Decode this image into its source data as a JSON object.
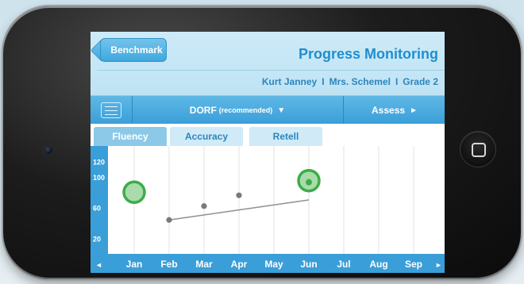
{
  "header": {
    "back_button": "Benchmark",
    "title": "Progress Monitoring",
    "student": "Kurt Janney",
    "teacher": "Mrs. Schemel",
    "grade": "Grade 2",
    "separator": "I"
  },
  "toolbar": {
    "list_icon": "list-icon",
    "measure": "DORF",
    "measure_note": "(recommended)",
    "measure_caret": "▼",
    "assess": "Assess",
    "assess_caret": "►"
  },
  "tabs": [
    {
      "label": "Fluency",
      "active": true
    },
    {
      "label": "Accuracy",
      "active": false
    },
    {
      "label": "Retell",
      "active": false
    }
  ],
  "chart_data": {
    "type": "scatter",
    "categories": [
      "Jan",
      "Feb",
      "Mar",
      "Apr",
      "May",
      "Jun",
      "Jul",
      "Aug",
      "Sep"
    ],
    "y_ticks": [
      120,
      100,
      60,
      20
    ],
    "ylim": [
      0,
      140
    ],
    "benchmarks": [
      {
        "x": "Jan",
        "y": 80
      },
      {
        "x": "Jun",
        "y": 95
      }
    ],
    "series": [
      {
        "points": [
          {
            "x": "Feb",
            "y": 44
          },
          {
            "x": "Mar",
            "y": 62
          },
          {
            "x": "Apr",
            "y": 76
          },
          {
            "x": "Jun",
            "y": 93
          }
        ]
      }
    ],
    "trend": [
      {
        "x": "Feb",
        "y": 44
      },
      {
        "x": "Jun",
        "y": 70
      }
    ],
    "nav_prev": "◄",
    "nav_next": "►",
    "colors": {
      "axis_band": "#3a9ed8",
      "label": "#2a86bf",
      "grid": "#dfe3e6",
      "point": "#7a7a7a",
      "trend": "#8f8f8f",
      "benchmark_fill": "#a9dcaa",
      "benchmark_ring": "#3cad4a"
    }
  }
}
